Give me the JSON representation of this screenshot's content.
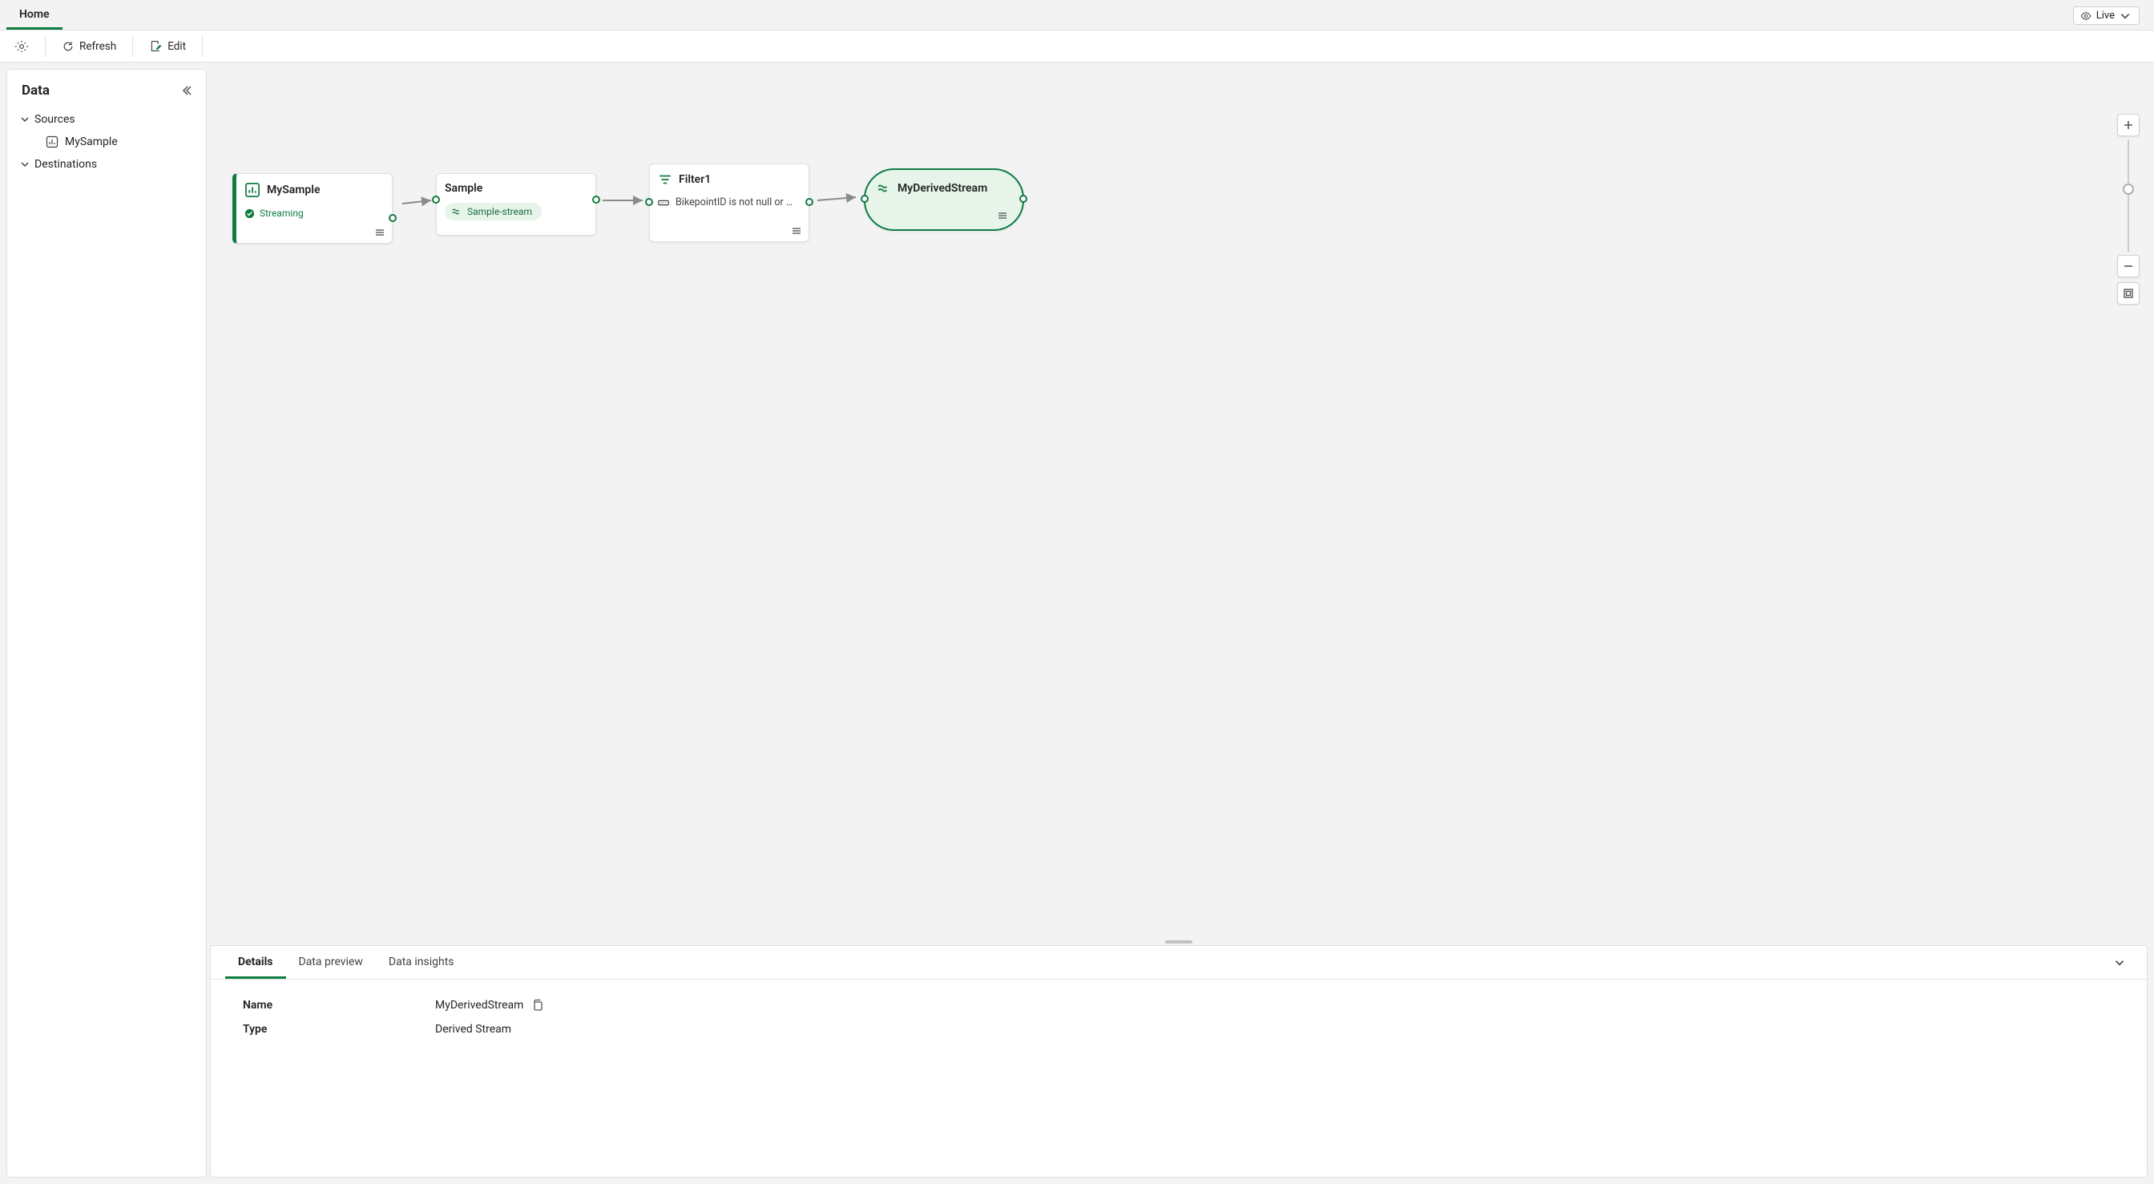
{
  "ribbon": {
    "tabs": [
      {
        "label": "Home",
        "active": true
      }
    ],
    "live_label": "Live"
  },
  "toolbar": {
    "refresh_label": "Refresh",
    "edit_label": "Edit"
  },
  "sidebar": {
    "title": "Data",
    "sections": {
      "sources": {
        "label": "Sources",
        "expanded": true
      },
      "destinations": {
        "label": "Destinations",
        "expanded": true
      }
    },
    "items": [
      {
        "label": "MySample"
      }
    ]
  },
  "flow": {
    "nodes": {
      "source": {
        "title": "MySample",
        "status": "Streaming"
      },
      "sample": {
        "title": "Sample",
        "chip": "Sample-stream"
      },
      "filter": {
        "title": "Filter1",
        "rule": "BikepointID is not null or e…"
      },
      "derived": {
        "title": "MyDerivedStream"
      }
    }
  },
  "bottom_tabs": [
    {
      "label": "Details",
      "active": true
    },
    {
      "label": "Data preview",
      "active": false
    },
    {
      "label": "Data insights",
      "active": false
    }
  ],
  "details": {
    "rows": [
      {
        "label": "Name",
        "value": "MyDerivedStream",
        "copyable": true
      },
      {
        "label": "Type",
        "value": "Derived Stream",
        "copyable": false
      }
    ]
  }
}
